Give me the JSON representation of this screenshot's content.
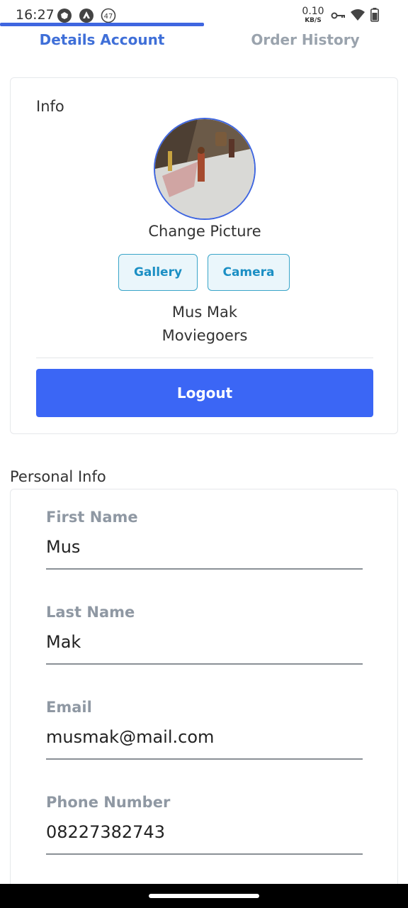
{
  "status_bar": {
    "time": "16:27",
    "notification_count": "47",
    "net_speed_value": "0.10",
    "net_speed_unit": "KB/S",
    "icons": [
      "shield-app-icon",
      "drive-app-icon",
      "notification-count-icon",
      "vpn-key-icon",
      "wifi-icon",
      "battery-icon"
    ]
  },
  "tabs": [
    {
      "label": "Details Account",
      "active": true
    },
    {
      "label": "Order History",
      "active": false
    }
  ],
  "info": {
    "title": "Info",
    "change_picture": "Change Picture",
    "gallery_label": "Gallery",
    "camera_label": "Camera",
    "name": "Mus Mak",
    "role": "Moviegoers",
    "logout_label": "Logout"
  },
  "personal_info": {
    "title": "Personal Info",
    "fields": [
      {
        "label": "First Name",
        "value": "Mus"
      },
      {
        "label": "Last Name",
        "value": "Mak"
      },
      {
        "label": "Email",
        "value": "musmak@mail.com"
      },
      {
        "label": "Phone Number",
        "value": "08227382743"
      }
    ]
  },
  "colors": {
    "accent": "#3f66e0",
    "logout_button": "#3b66f5",
    "secondary_button_text": "#1b8fc4",
    "label_gray": "#8f98a3"
  }
}
